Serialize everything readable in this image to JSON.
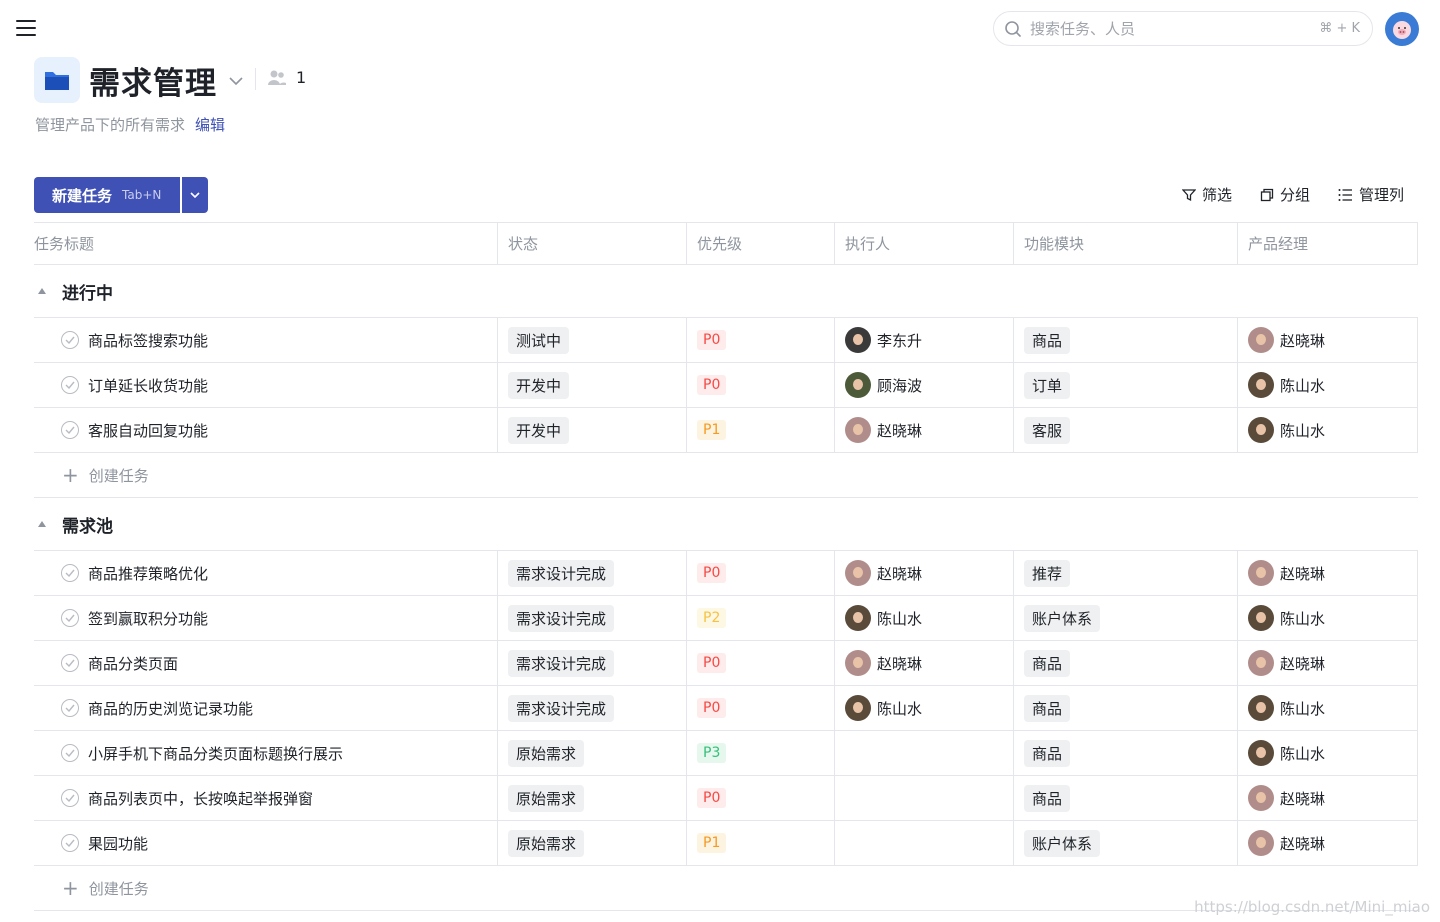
{
  "topbar": {
    "search_placeholder": "搜索任务、人员",
    "search_shortcut": "⌘ + K"
  },
  "project": {
    "title": "需求管理",
    "member_count": "1",
    "description": "管理产品下的所有需求",
    "edit_label": "编辑"
  },
  "actions": {
    "new_task_label": "新建任务",
    "new_task_shortcut": "Tab+N",
    "filter_label": "筛选",
    "group_label": "分组",
    "manage_columns_label": "管理列"
  },
  "columns": [
    "任务标题",
    "状态",
    "优先级",
    "执行人",
    "功能模块",
    "产品经理"
  ],
  "groups": [
    {
      "name": "进行中",
      "create_label": "创建任务",
      "rows": [
        {
          "title": "商品标签搜索功能",
          "status": "测试中",
          "priority": "P0",
          "assignee": "李东升",
          "assignee_avatar": "li",
          "module": "商品",
          "pm": "赵晓琳",
          "pm_avatar": "zhao"
        },
        {
          "title": "订单延长收货功能",
          "status": "开发中",
          "priority": "P0",
          "assignee": "顾海波",
          "assignee_avatar": "gu",
          "module": "订单",
          "pm": "陈山水",
          "pm_avatar": "chen"
        },
        {
          "title": "客服自动回复功能",
          "status": "开发中",
          "priority": "P1",
          "assignee": "赵晓琳",
          "assignee_avatar": "zhao",
          "module": "客服",
          "pm": "陈山水",
          "pm_avatar": "chen"
        }
      ]
    },
    {
      "name": "需求池",
      "create_label": "创建任务",
      "rows": [
        {
          "title": "商品推荐策略优化",
          "status": "需求设计完成",
          "priority": "P0",
          "assignee": "赵晓琳",
          "assignee_avatar": "zhao",
          "module": "推荐",
          "pm": "赵晓琳",
          "pm_avatar": "zhao"
        },
        {
          "title": "签到赢取积分功能",
          "status": "需求设计完成",
          "priority": "P2",
          "assignee": "陈山水",
          "assignee_avatar": "chen",
          "module": "账户体系",
          "pm": "陈山水",
          "pm_avatar": "chen"
        },
        {
          "title": "商品分类页面",
          "status": "需求设计完成",
          "priority": "P0",
          "assignee": "赵晓琳",
          "assignee_avatar": "zhao",
          "module": "商品",
          "pm": "赵晓琳",
          "pm_avatar": "zhao"
        },
        {
          "title": "商品的历史浏览记录功能",
          "status": "需求设计完成",
          "priority": "P0",
          "assignee": "陈山水",
          "assignee_avatar": "chen",
          "module": "商品",
          "pm": "陈山水",
          "pm_avatar": "chen"
        },
        {
          "title": "小屏手机下商品分类页面标题换行展示",
          "status": "原始需求",
          "priority": "P3",
          "assignee": "",
          "assignee_avatar": "",
          "module": "商品",
          "pm": "陈山水",
          "pm_avatar": "chen"
        },
        {
          "title": "商品列表页中，长按唤起举报弹窗",
          "status": "原始需求",
          "priority": "P0",
          "assignee": "",
          "assignee_avatar": "",
          "module": "商品",
          "pm": "赵晓琳",
          "pm_avatar": "zhao"
        },
        {
          "title": "果园功能",
          "status": "原始需求",
          "priority": "P1",
          "assignee": "",
          "assignee_avatar": "",
          "module": "账户体系",
          "pm": "赵晓琳",
          "pm_avatar": "zhao"
        }
      ]
    }
  ],
  "priority_colors": {
    "P0": {
      "fg": "#f54a45",
      "bg": "#fdeceb"
    },
    "P1": {
      "fg": "#f59a23",
      "bg": "#fdf3e1"
    },
    "P2": {
      "fg": "#f7c244",
      "bg": "#fdf8e4"
    },
    "P3": {
      "fg": "#34c07a",
      "bg": "#e6f7ee"
    }
  },
  "accent_color": "#3f51b5",
  "watermark": "https://blog.csdn.net/Mini_miao"
}
